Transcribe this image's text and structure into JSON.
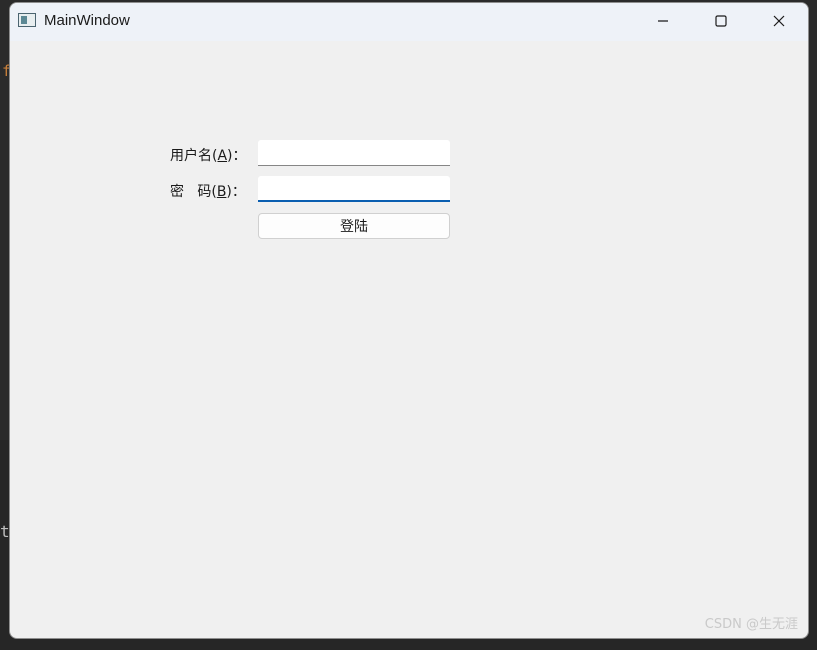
{
  "window": {
    "title": "MainWindow",
    "controls": {
      "minimize": "minimize",
      "maximize": "maximize",
      "close": "close"
    }
  },
  "form": {
    "username_label_prefix": "用户名(",
    "username_label_mnemonic": "A",
    "username_label_suffix": ")：",
    "username_value": "",
    "password_label_prefix": "密   码(",
    "password_label_mnemonic": "B",
    "password_label_suffix": ")：",
    "password_value": "",
    "login_button": "登陆"
  },
  "background": {
    "orange_char": "f",
    "gray_char": "t"
  },
  "watermark": "CSDN @生无涯",
  "icons": [
    "app-window-icon",
    "minimize-icon",
    "maximize-icon",
    "close-icon"
  ],
  "colors": {
    "window_bg": "#f0f0f0",
    "titlebar_bg": "#eef2f8",
    "focus_underline": "#0a5eb0"
  }
}
